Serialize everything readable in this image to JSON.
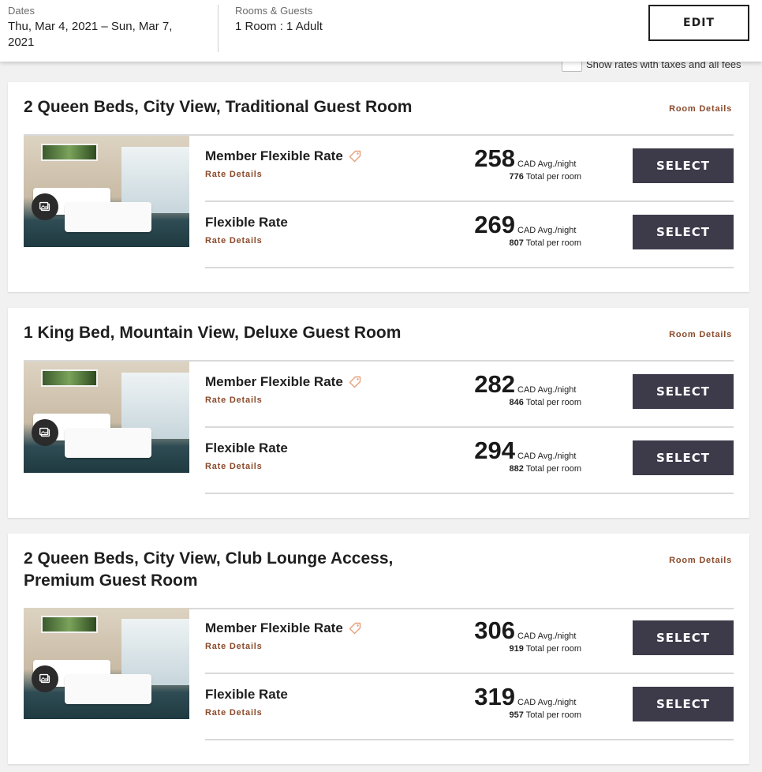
{
  "header": {
    "dates_label": "Dates",
    "dates_value": "Thu, Mar 4, 2021 – Sun, Mar 7, 2021",
    "rooms_label": "Rooms & Guests",
    "rooms_value": "1 Room : 1 Adult",
    "edit_label": "EDIT"
  },
  "tax_toggle": {
    "label": "Show rates with taxes and all fees",
    "checked": false
  },
  "colors": {
    "accent": "#8a4a2b",
    "select_button": "#3d3b4a"
  },
  "rooms": [
    {
      "title": "2 Queen Beds, City View, Traditional Guest Room",
      "details_label": "Room Details",
      "photo_icon": "gallery-icon",
      "rates": [
        {
          "name": "Member Flexible Rate",
          "member_tag": true,
          "details_label": "Rate Details",
          "price": "258",
          "unit": "CAD Avg./night",
          "total": "776",
          "total_label": "Total per room",
          "select_label": "SELECT"
        },
        {
          "name": "Flexible Rate",
          "member_tag": false,
          "details_label": "Rate Details",
          "price": "269",
          "unit": "CAD Avg./night",
          "total": "807",
          "total_label": "Total per room",
          "select_label": "SELECT"
        }
      ]
    },
    {
      "title": "1 King Bed, Mountain View, Deluxe Guest Room",
      "details_label": "Room Details",
      "photo_icon": "gallery-icon",
      "rates": [
        {
          "name": "Member Flexible Rate",
          "member_tag": true,
          "details_label": "Rate Details",
          "price": "282",
          "unit": "CAD Avg./night",
          "total": "846",
          "total_label": "Total per room",
          "select_label": "SELECT"
        },
        {
          "name": "Flexible Rate",
          "member_tag": false,
          "details_label": "Rate Details",
          "price": "294",
          "unit": "CAD Avg./night",
          "total": "882",
          "total_label": "Total per room",
          "select_label": "SELECT"
        }
      ]
    },
    {
      "title": "2 Queen Beds, City View, Club Lounge Access, Premium Guest Room",
      "details_label": "Room Details",
      "photo_icon": "gallery-icon",
      "rates": [
        {
          "name": "Member Flexible Rate",
          "member_tag": true,
          "details_label": "Rate Details",
          "price": "306",
          "unit": "CAD Avg./night",
          "total": "919",
          "total_label": "Total per room",
          "select_label": "SELECT"
        },
        {
          "name": "Flexible Rate",
          "member_tag": false,
          "details_label": "Rate Details",
          "price": "319",
          "unit": "CAD Avg./night",
          "total": "957",
          "total_label": "Total per room",
          "select_label": "SELECT"
        }
      ]
    }
  ]
}
